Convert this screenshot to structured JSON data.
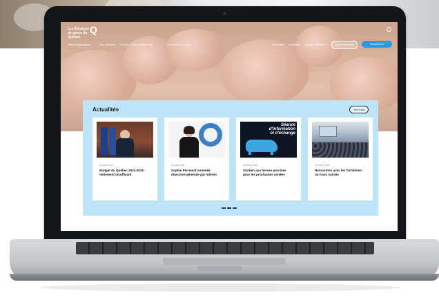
{
  "site": {
    "logo_text": "Les Éleveurs de porcs du Québec",
    "logo_mark": "Q",
    "nav_left": [
      "Notre organisation",
      "Nos éleveurs",
      "Le porc et ses chiffres clés",
      "Un secteur de pros"
    ],
    "nav_right": [
      "Nouvelles",
      "Actualités",
      "Espace éleveurs",
      "Zone membres"
    ],
    "cta_label": "Recherche",
    "brand_color": "#2b5fa8"
  },
  "news": {
    "heading": "Actualités",
    "see_all_label": "Voir tous",
    "cards": [
      {
        "date": "12 mars 2024",
        "title": "Budget du Québec 2024-2025 : nettement insuffisant",
        "image": "official-at-podium-photo"
      },
      {
        "date": "11 mars 2024",
        "title": "Sophie Perreault nommée directrice générale par intérim",
        "image": "woman-portrait-photo"
      },
      {
        "date": "28 février 2024",
        "title": "Soutien aux fermes porcines pour les prochaines années",
        "image": "pig-silhouette-poster"
      },
      {
        "date": "21 février 2024",
        "title": "Rencontres avec les fortalières : un franc succès",
        "image": "conference-audience-photo"
      }
    ],
    "poster_text": [
      "Séance",
      "d'information",
      "et d'échange"
    ]
  },
  "pagination": {
    "pages": 3,
    "current": 1
  }
}
